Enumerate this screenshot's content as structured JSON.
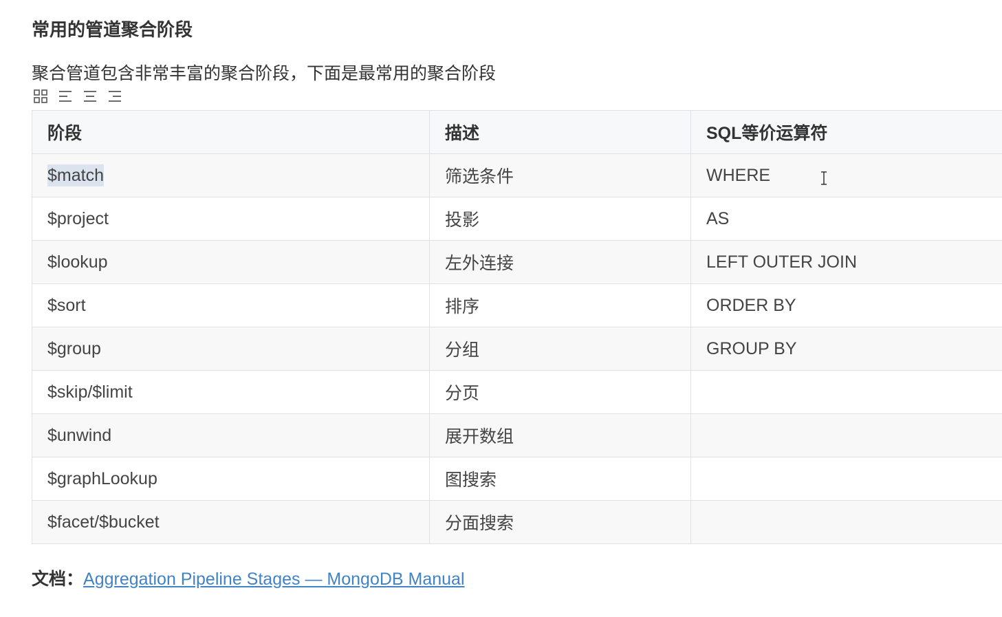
{
  "section": {
    "heading": "常用的管道聚合阶段",
    "intro": "聚合管道包含非常丰富的聚合阶段，下面是最常用的聚合阶段"
  },
  "toolbar": {
    "icons": [
      "grid-icon",
      "align-left-icon",
      "align-center-icon",
      "align-right-icon"
    ]
  },
  "table": {
    "headers": [
      "阶段",
      "描述",
      "SQL等价运算符"
    ],
    "rows": [
      [
        "$match",
        "筛选条件",
        "WHERE"
      ],
      [
        "$project",
        "投影",
        "AS"
      ],
      [
        "$lookup",
        "左外连接",
        "LEFT OUTER JOIN"
      ],
      [
        "$sort",
        "排序",
        "ORDER BY"
      ],
      [
        "$group",
        "分组",
        "GROUP BY"
      ],
      [
        "$skip/$limit",
        "分页",
        ""
      ],
      [
        "$unwind",
        "展开数组",
        ""
      ],
      [
        "$graphLookup",
        "图搜索",
        ""
      ],
      [
        "$facet/$bucket",
        "分面搜索",
        ""
      ]
    ]
  },
  "footer": {
    "label": "文档：",
    "link_text": "Aggregation Pipeline Stages — MongoDB Manual"
  },
  "colors": {
    "link": "#4183c4",
    "border": "#dfe2e5",
    "header_bg": "#f6f8fa",
    "stripe_bg": "#f8f8f8",
    "selection": "#dbe4ee"
  }
}
